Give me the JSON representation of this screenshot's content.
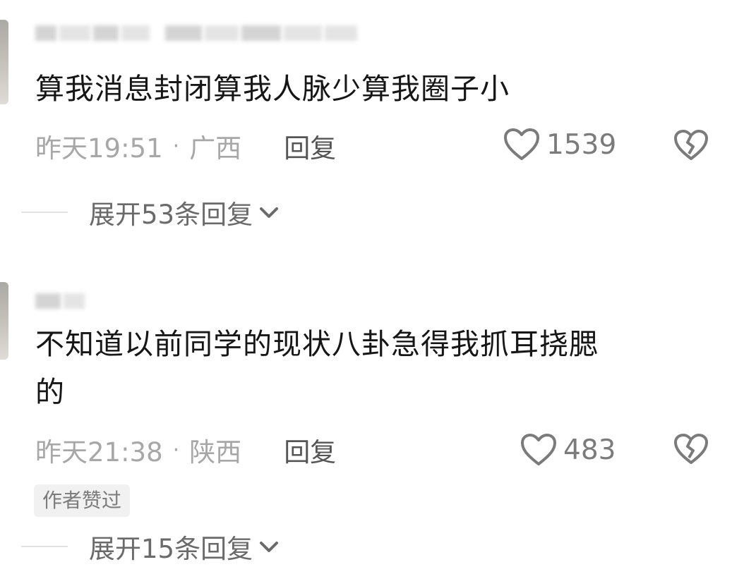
{
  "comments": [
    {
      "text": "算我消息封闭算我人脉少算我圈子小",
      "time": "昨天19:51",
      "separator": "·",
      "region": "广西",
      "reply_label": "回复",
      "likes": "1539",
      "expand_label": "展开53条回复"
    },
    {
      "text": "不知道以前同学的现状八卦急得我抓耳挠腮\n的",
      "time": "昨天21:38",
      "separator": "·",
      "region": "陕西",
      "reply_label": "回复",
      "likes": "483",
      "badge": "作者赞过",
      "expand_label": "展开15条回复"
    }
  ],
  "icons": {
    "like": "heart-outline-icon",
    "dislike": "broken-heart-icon",
    "expand": "chevron-down-icon"
  },
  "colors": {
    "text": "#161616",
    "meta": "#a7a7a7",
    "reply": "#555555",
    "count": "#7b7b7b",
    "expand": "#6a6a6a",
    "badge_bg": "#f1f1f1"
  }
}
